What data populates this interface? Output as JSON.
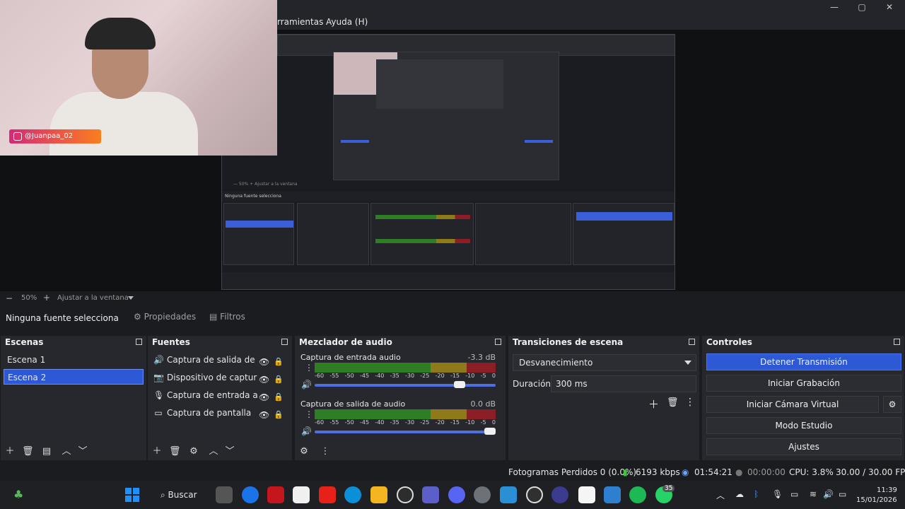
{
  "menu": {
    "tools_partial": "rramientas",
    "help": "Ayuda (H)"
  },
  "webcam": {
    "instagram_handle": "@Juanpaa_02"
  },
  "zoom": {
    "minus": "−",
    "percent": "50%",
    "plus": "+",
    "fit_label": "Ajustar a la ventana"
  },
  "source_bar": {
    "no_source": "Ninguna fuente selecciona",
    "properties": "Propiedades",
    "filters": "Filtros"
  },
  "scenes": {
    "title": "Escenas",
    "items": [
      "Escena 1",
      "Escena 2"
    ],
    "selected_index": 1
  },
  "sources": {
    "title": "Fuentes",
    "items": [
      {
        "label": "Captura de salida de audi",
        "icon": "speaker-icon"
      },
      {
        "label": "Dispositivo de captura de",
        "icon": "camera-icon"
      },
      {
        "label": "Captura de entrada audic",
        "icon": "microphone-icon"
      },
      {
        "label": "Captura de pantalla",
        "icon": "monitor-icon"
      }
    ]
  },
  "mixer": {
    "title": "Mezclador de audio",
    "ticks": [
      "-60",
      "-55",
      "-50",
      "-45",
      "-40",
      "-35",
      "-30",
      "-25",
      "-20",
      "-15",
      "-10",
      "-5",
      "0"
    ],
    "tracks": [
      {
        "name": "Captura de entrada audio",
        "db": "-3.3 dB",
        "volume": 0.82
      },
      {
        "name": "Captura de salida de audio",
        "db": "0.0 dB",
        "volume": 1.0
      }
    ]
  },
  "transitions": {
    "title": "Transiciones de escena",
    "selected": "Desvanecimiento",
    "duration_label": "Duración",
    "duration_value": "300 ms"
  },
  "controls": {
    "title": "Controles",
    "buttons": [
      "Detener Transmisión",
      "Iniciar Grabación",
      "Iniciar Cámara Virtual",
      "Modo Estudio",
      "Ajustes"
    ]
  },
  "status": {
    "dropped_frames": "Fotogramas Perdidos 0 (0.0%)",
    "bitrate": "6193 kbps",
    "stream_time": "01:54:21",
    "record_time": "00:00:00",
    "cpu": "CPU: 3.8%",
    "fps": "30.00 / 30.00 FPS"
  },
  "taskbar": {
    "search": "Buscar",
    "teams_badge": "35",
    "time": "11:39",
    "date": "15/01/2026",
    "colors": {
      "accent": "#2e59d6",
      "windows": "#1e90ff",
      "spotify": "#1db954",
      "youtube": "#e62117"
    }
  }
}
